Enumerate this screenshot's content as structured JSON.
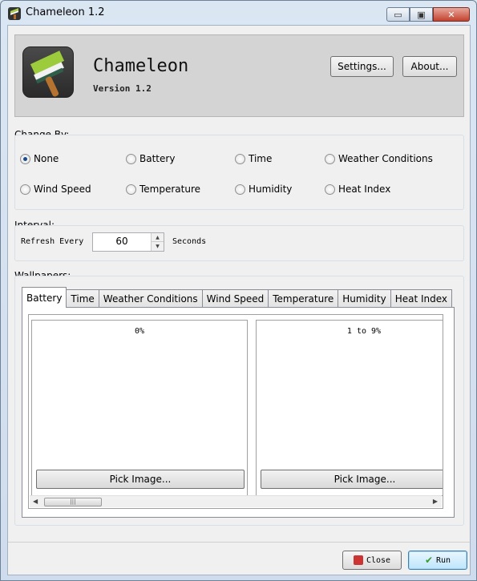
{
  "window": {
    "title": "Chameleon 1.2",
    "minimize_glyph": "▭",
    "maximize_glyph": "▣",
    "close_glyph": "✕"
  },
  "header": {
    "app_name": "Chameleon",
    "version": "Version 1.2",
    "settings_label": "Settings...",
    "about_label": "About..."
  },
  "change_by": {
    "label": "Change By:",
    "options": [
      "None",
      "Battery",
      "Time",
      "Weather Conditions",
      "Wind Speed",
      "Temperature",
      "Humidity",
      "Heat Index"
    ],
    "selected": "None"
  },
  "interval": {
    "label": "Interval:",
    "refresh_label": "Refresh Every",
    "value": "60",
    "unit": "Seconds"
  },
  "wallpapers": {
    "label": "Wallpapers:",
    "tabs": [
      "Battery",
      "Time",
      "Weather Conditions",
      "Wind Speed",
      "Temperature",
      "Humidity",
      "Heat Index"
    ],
    "active_tab": "Battery",
    "slots": [
      {
        "label": "0%",
        "button": "Pick Image..."
      },
      {
        "label": "1 to 9%",
        "button": "Pick Image..."
      }
    ],
    "scroll_left": "◀",
    "scroll_right": "▶",
    "scroll_thumb": "|||"
  },
  "footer": {
    "close_label": "Close",
    "run_label": "Run",
    "run_glyph": "✔"
  }
}
